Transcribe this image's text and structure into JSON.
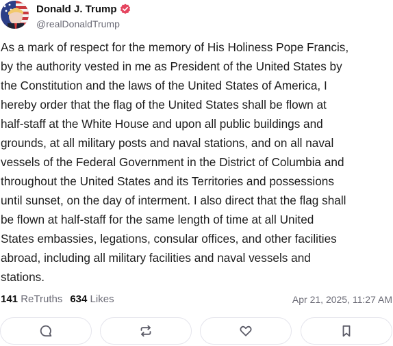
{
  "post": {
    "display_name": "Donald J. Trump",
    "handle": "@realDonaldTrump",
    "verified": true,
    "body_lines": [
      "As a mark of respect for the memory of His Holiness Pope Francis,",
      "by the authority vested in me as President of the United States by",
      "the Constitution and the laws of the United States of America, I",
      "hereby order that the flag of the United States shall be flown at",
      "half-staff at the White House and upon all public buildings and",
      "grounds, at all military posts and naval stations, and on all naval",
      "vessels of the Federal Government in the District of Columbia and",
      "throughout the United States and its Territories and possessions",
      "until sunset, on the day of interment. I also direct that the flag shall",
      "be flown at half-staff for the same length of time at all United",
      "States embassies, legations, consular offices, and other facilities",
      "abroad, including all military facilities and naval vessels and",
      "stations."
    ],
    "retruths_count": "141",
    "retruths_label": "ReTruths",
    "likes_count": "634",
    "likes_label": "Likes",
    "timestamp": "Apr 21, 2025, 11:27 AM"
  },
  "actions": [
    {
      "name": "reply",
      "icon": "comment-icon"
    },
    {
      "name": "retruth",
      "icon": "repost-icon"
    },
    {
      "name": "like",
      "icon": "heart-icon"
    },
    {
      "name": "bookmark",
      "icon": "bookmark-icon"
    }
  ],
  "colors": {
    "verified_badge": "#e5455f",
    "secondary_text": "#6b6b76",
    "button_border": "#e4e4ec",
    "icon": "#5a5a66"
  }
}
